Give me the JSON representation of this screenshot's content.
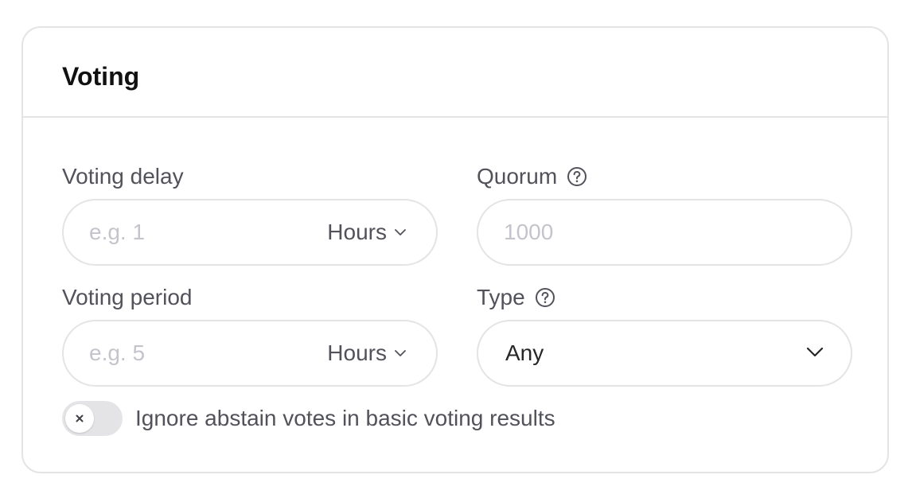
{
  "card": {
    "title": "Voting"
  },
  "fields": {
    "voting_delay": {
      "label": "Voting delay",
      "placeholder": "e.g. 1",
      "value": "",
      "unit": "Hours"
    },
    "quorum": {
      "label": "Quorum",
      "placeholder": "1000",
      "value": "",
      "help_icon": "question-circle-icon"
    },
    "voting_period": {
      "label": "Voting period",
      "placeholder": "e.g. 5",
      "value": "",
      "unit": "Hours"
    },
    "type": {
      "label": "Type",
      "selected": "Any",
      "help_icon": "question-circle-icon"
    }
  },
  "toggle": {
    "label": "Ignore abstain votes in basic voting results",
    "state": "off"
  },
  "colors": {
    "border": "#e4e4e7",
    "label": "#52525b",
    "title": "#111111",
    "placeholder": "#c4c4cc",
    "toggle_track": "#e4e4e7"
  }
}
